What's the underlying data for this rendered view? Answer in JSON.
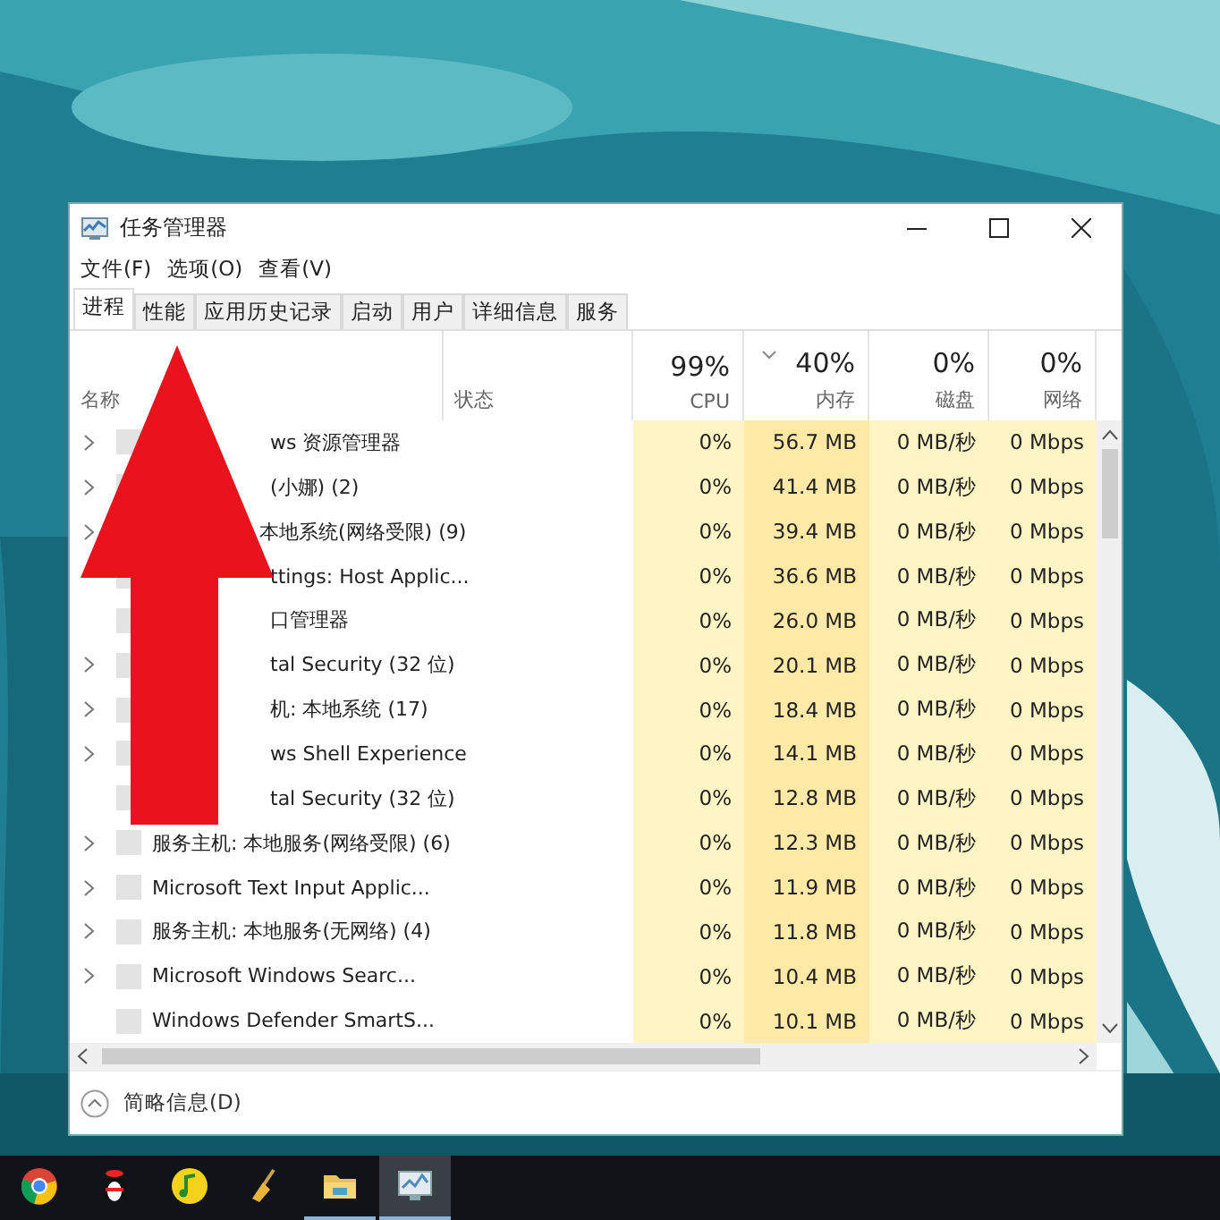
{
  "window": {
    "title": "任务管理器"
  },
  "menu": [
    "文件(F)",
    "选项(O)",
    "查看(V)"
  ],
  "tabs": [
    {
      "label": "进程",
      "selected": true
    },
    {
      "label": "性能",
      "selected": false
    },
    {
      "label": "应用历史记录",
      "selected": false
    },
    {
      "label": "启动",
      "selected": false
    },
    {
      "label": "用户",
      "selected": false
    },
    {
      "label": "详细信息",
      "selected": false
    },
    {
      "label": "服务",
      "selected": false
    }
  ],
  "columns": [
    {
      "label": "名称"
    },
    {
      "label": "状态"
    },
    {
      "percent": "99%",
      "label": "CPU",
      "sorted": false
    },
    {
      "percent": "40%",
      "label": "内存",
      "sorted": true
    },
    {
      "percent": "0%",
      "label": "磁盘",
      "sorted": false
    },
    {
      "percent": "0%",
      "label": "网络",
      "sorted": false
    }
  ],
  "rows": [
    {
      "name": "ws 资源管理器",
      "kind": "cut",
      "expandable": true,
      "cpu": "0%",
      "memory": "56.7 MB",
      "disk": "0 MB/秒",
      "network": "0 Mbps"
    },
    {
      "name": "(小娜) (2)",
      "kind": "cut",
      "expandable": true,
      "cpu": "0%",
      "memory": "41.4 MB",
      "disk": "0 MB/秒",
      "network": "0 Mbps"
    },
    {
      "name": "本地系统(网络受限) (9)",
      "kind": "covered",
      "expandable": true,
      "cpu": "0%",
      "memory": "39.4 MB",
      "disk": "0 MB/秒",
      "network": "0 Mbps"
    },
    {
      "name": "ttings: Host Applic...",
      "kind": "cut",
      "expandable": false,
      "cpu": "0%",
      "memory": "36.6 MB",
      "disk": "0 MB/秒",
      "network": "0 Mbps"
    },
    {
      "name": "口管理器",
      "kind": "cut",
      "expandable": false,
      "cpu": "0%",
      "memory": "26.0 MB",
      "disk": "0 MB/秒",
      "network": "0 Mbps"
    },
    {
      "name": "tal Security (32 位)",
      "kind": "cut",
      "expandable": true,
      "cpu": "0%",
      "memory": "20.1 MB",
      "disk": "0 MB/秒",
      "network": "0 Mbps"
    },
    {
      "name": "机: 本地系统 (17)",
      "kind": "cut",
      "expandable": true,
      "cpu": "0%",
      "memory": "18.4 MB",
      "disk": "0 MB/秒",
      "network": "0 Mbps"
    },
    {
      "name": "ws Shell Experience",
      "kind": "cut",
      "expandable": true,
      "cpu": "0%",
      "memory": "14.1 MB",
      "disk": "0 MB/秒",
      "network": "0 Mbps"
    },
    {
      "name": "tal Security (32 位)",
      "kind": "cut",
      "expandable": false,
      "cpu": "0%",
      "memory": "12.8 MB",
      "disk": "0 MB/秒",
      "network": "0 Mbps"
    },
    {
      "name": "服务主机: 本地服务(网络受限) (6)",
      "kind": "full",
      "expandable": true,
      "cpu": "0%",
      "memory": "12.3 MB",
      "disk": "0 MB/秒",
      "network": "0 Mbps"
    },
    {
      "name": "Microsoft Text Input Applic...",
      "kind": "full",
      "expandable": true,
      "cpu": "0%",
      "memory": "11.9 MB",
      "disk": "0 MB/秒",
      "network": "0 Mbps"
    },
    {
      "name": "服务主机: 本地服务(无网络) (4)",
      "kind": "full",
      "expandable": true,
      "cpu": "0%",
      "memory": "11.8 MB",
      "disk": "0 MB/秒",
      "network": "0 Mbps"
    },
    {
      "name": "Microsoft Windows Searc...",
      "kind": "full",
      "expandable": true,
      "cpu": "0%",
      "memory": "10.4 MB",
      "disk": "0 MB/秒",
      "network": "0 Mbps"
    },
    {
      "name": "Windows Defender SmartS...",
      "kind": "full",
      "expandable": false,
      "cpu": "0%",
      "memory": "10.1 MB",
      "disk": "0 MB/秒",
      "network": "0 Mbps"
    }
  ],
  "footer": {
    "label": "简略信息(D)"
  },
  "taskbar": [
    {
      "kind": "browser",
      "selected": false,
      "running": false
    },
    {
      "kind": "penguin",
      "selected": false,
      "running": false
    },
    {
      "kind": "music",
      "selected": false,
      "running": false
    },
    {
      "kind": "broom",
      "selected": false,
      "running": false
    },
    {
      "kind": "folder",
      "selected": false,
      "running": true
    },
    {
      "kind": "monitor",
      "selected": true,
      "running": true
    }
  ]
}
